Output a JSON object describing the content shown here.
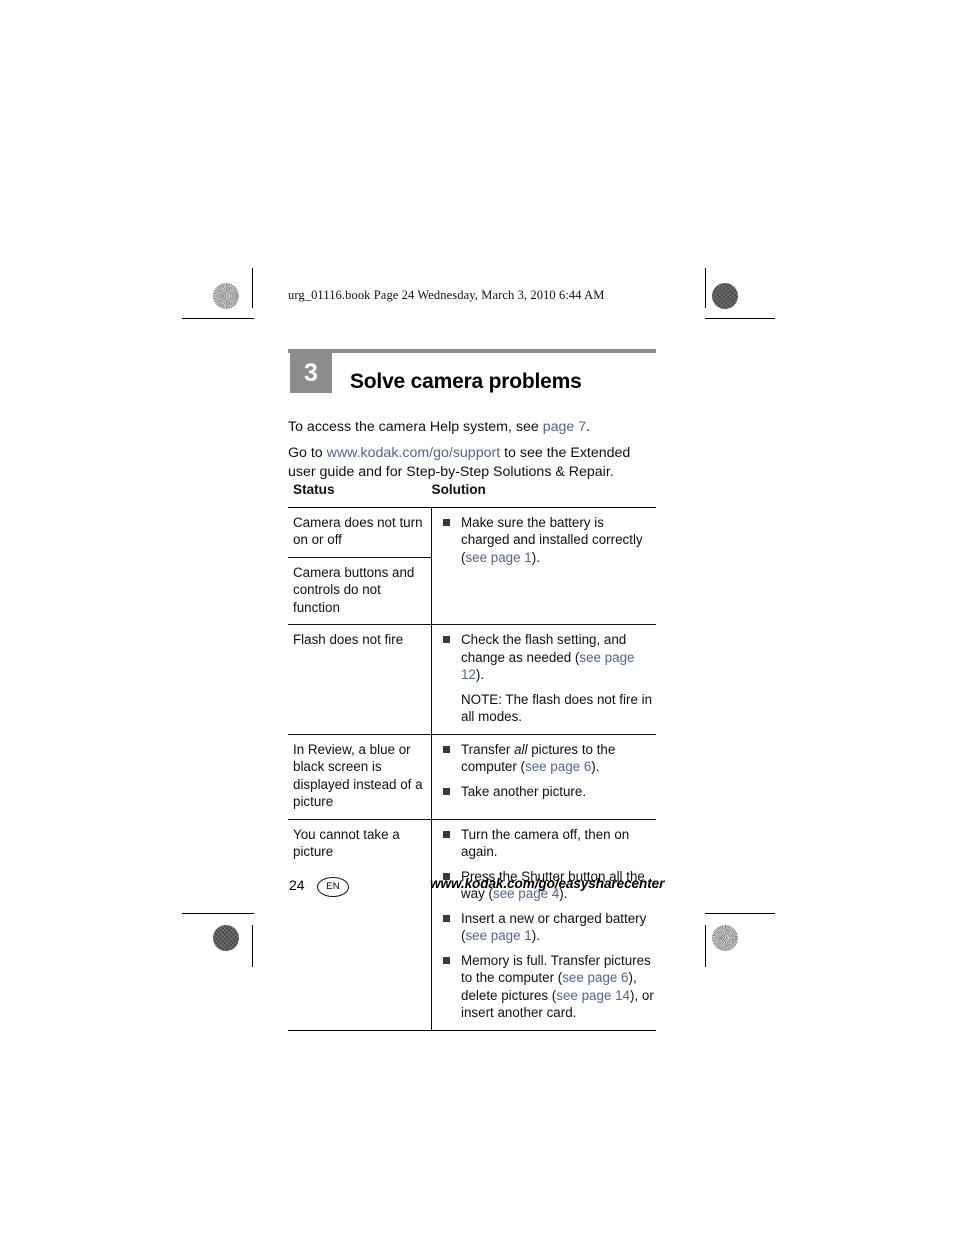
{
  "page_header": "urg_01116.book  Page 24  Wednesday, March 3, 2010  6:44 AM",
  "chapter": {
    "number": "3",
    "title": "Solve camera problems"
  },
  "intro": {
    "line1_before": "To access the camera Help system, see ",
    "line1_link": "page 7",
    "line1_after": ".",
    "line2_before": "Go to ",
    "line2_link": "www.kodak.com/go/support",
    "line2_after": " to see the Extended user guide and for Step-by-Step Solutions & Repair."
  },
  "table": {
    "headers": {
      "status": "Status",
      "solution": "Solution"
    },
    "rows": [
      {
        "status": "Camera does not turn on or off",
        "bullets": [
          {
            "pre": "Make sure the battery is charged and installed correctly (",
            "link": "see page 1",
            "post": ")."
          }
        ]
      },
      {
        "status": "Camera buttons and controls do not function",
        "bullets": []
      },
      {
        "status": "Flash does not fire",
        "bullets": [
          {
            "pre": "Check the flash setting, and change as needed (",
            "link": "see page 12",
            "post": ")."
          }
        ],
        "note": "NOTE:  The flash does not fire in all modes."
      },
      {
        "status": "In Review, a blue or black screen is displayed instead of a picture",
        "bullets": [
          {
            "pre": "Transfer ",
            "emph": "all",
            "mid": " pictures to the computer (",
            "link": "see page 6",
            "post": ")."
          },
          {
            "pre": "Take another picture.",
            "link": "",
            "post": ""
          }
        ]
      },
      {
        "status": "You cannot take a picture",
        "bullets": [
          {
            "pre": "Turn the camera off, then on again.",
            "link": "",
            "post": ""
          },
          {
            "pre": "Press the Shutter button all the way (",
            "link": "see page 4",
            "post": ")."
          },
          {
            "pre": "Insert a new or charged battery (",
            "link": "see page 1",
            "post": ")."
          },
          {
            "pre": "Memory is full. Transfer pictures to the computer (",
            "link": "see page 6",
            "mid2": "), delete pictures (",
            "link2": "see page 14",
            "post": "), or insert another card."
          }
        ]
      }
    ]
  },
  "footer": {
    "page_number": "24",
    "language_badge": "EN",
    "url": "www.kodak.com/go/easysharecenter"
  },
  "colors": {
    "link": "#51668f",
    "chapter_block": "#8c8c8c",
    "bullet": "#3a3a3a"
  }
}
